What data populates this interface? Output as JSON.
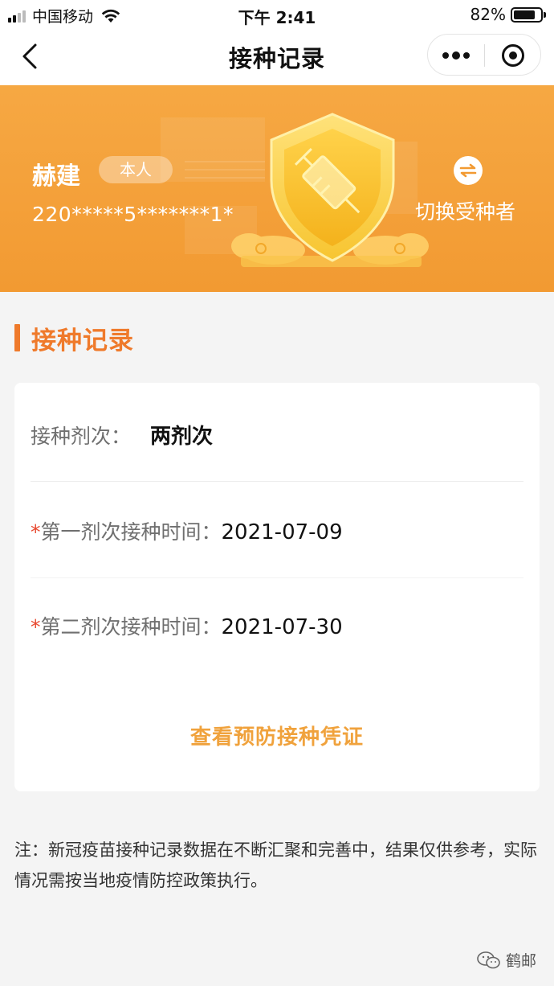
{
  "status_bar": {
    "carrier": "中国移动",
    "time": "下午 2:41",
    "battery": "82%",
    "battery_level": 0.82
  },
  "nav": {
    "title": "接种记录",
    "back_icon": "chevron-left-icon",
    "more_icon": "more-dots-icon",
    "close_icon": "target-circle-icon"
  },
  "banner": {
    "name": "赫建",
    "tag": "本人",
    "id_number": "220*****5*******1*",
    "switch_label": "切换受种者",
    "switch_icon": "swap-arrows-icon",
    "emblem_icon": "shield-syringe-icon",
    "colors": {
      "background": "#f29a32",
      "text": "#ffffff"
    }
  },
  "section": {
    "title": "接种记录",
    "accent_color": "#ef7a2b"
  },
  "record": {
    "doses_label": "接种剂次：",
    "doses_value": "两剂次",
    "required_mark": "*",
    "first_label": "第一剂次接种时间：",
    "first_value": "2021-07-09",
    "second_label": "第二剂次接种时间：",
    "second_value": "2021-07-30",
    "certificate_link": "查看预防接种凭证",
    "link_color": "#f0a23c"
  },
  "note": {
    "text": "注：新冠疫苗接种记录数据在不断汇聚和完善中，结果仅供参考，实际情况需按当地疫情防控政策执行。"
  },
  "watermark": {
    "text": "鹤邮",
    "icon": "wechat-icon"
  }
}
